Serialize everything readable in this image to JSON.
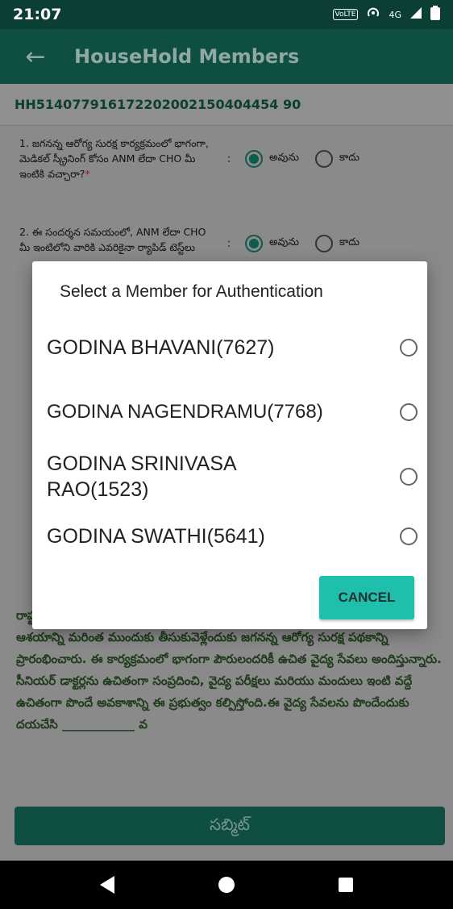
{
  "status_bar": {
    "time": "21:07",
    "volte_label": "VoLTE",
    "network": "4G"
  },
  "app_bar": {
    "title": "HouseHold Members"
  },
  "household_id": "HH514077916172202002150404454 90",
  "questions": [
    {
      "text": "1. జగనన్న ఆరోగ్య సురక్ష కార్యక్రమంలో భాగంగా, మెడికల్ స్క్రీనింగ్ కోసం ANM లేదా CHO మీ ఇంటికి వచ్చారా?",
      "required_mark": "*",
      "yes": "అవును",
      "no": "కాదు"
    },
    {
      "text": "2. ఈ సందర్శన సమయంలో, ANM లేదా CHO మీ ఇంటిలోని వారికి ఎవరికైనా ర్యాపిడ్ టెస్ట్‌లు",
      "required_mark": "",
      "yes": "అవును",
      "no": "కాదు"
    }
  ],
  "paragraph": "రాష్ట్ర గౌరవ ముఖ్యమంత్రి వర్యులు శ్రీ. వై. ఎస్ జగన్ మోహన్ రెడ్డి గారి ఆశయం. ఈ ఆశయాన్ని మరింత ముందుకు తీసుకువెళ్లేందుకు జగనన్న ఆరోగ్య సురక్ష పథకాన్ని ప్రారంభించారు. ఈ కార్యక్రమంలో భాగంగా పౌరులందరికీ ఉచిత వైద్య సేవలు అందిస్తున్నారు. సీనియర్ డాక్టర్లను ఉచితంగా సంప్రదించి, వైద్య పరీక్షలు మరియు మందులు ఇంటి వద్దే ఉచితంగా పొందే అవకాశాన్ని ఈ ప్రభుత్వం కల్పిస్తోంది.ఈ వైద్య సేవలను పొందేందుకు దయచేసి ____________ వ",
  "submit_label": "సబ్మిట్",
  "dialog": {
    "title": "Select a Member for Authentication",
    "members": [
      {
        "name": "GODINA BHAVANI(7627)"
      },
      {
        "name": "GODINA NAGENDRAMU(7768)"
      },
      {
        "name": "GODINA SRINIVASA RAO(1523)"
      },
      {
        "name": "GODINA SWATHI(5641)"
      }
    ],
    "cancel_label": "CANCEL"
  },
  "colors": {
    "primary_dark": "#0b3f35",
    "primary": "#0f4f43",
    "accent": "#1fbfae",
    "radio_checked": "#0d5b4d"
  }
}
